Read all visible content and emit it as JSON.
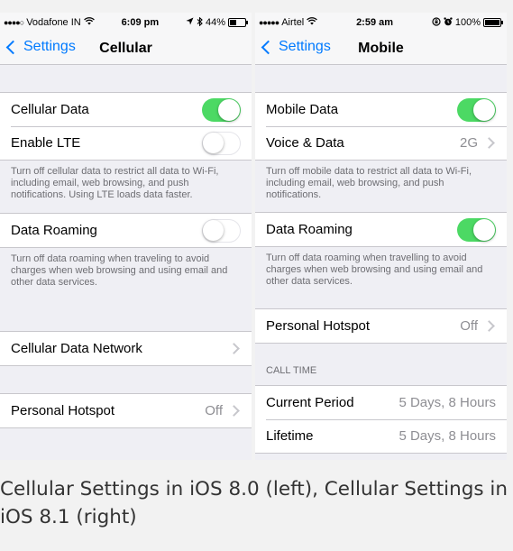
{
  "left": {
    "status": {
      "signal_dots": "●●●●○",
      "carrier": "Vodafone IN",
      "time": "6:09 pm",
      "battery": "44%",
      "battery_level": 0.44
    },
    "nav": {
      "back_label": "Settings",
      "title": "Cellular"
    },
    "group1": {
      "cellular_data": {
        "label": "Cellular Data",
        "on": true
      },
      "enable_lte": {
        "label": "Enable LTE",
        "on": false
      }
    },
    "footer1": "Turn off cellular data to restrict all data to Wi-Fi, including email, web browsing, and push notifications. Using LTE loads data faster.",
    "data_roaming": {
      "label": "Data Roaming",
      "on": false
    },
    "footer2": "Turn off data roaming when traveling to avoid charges when web browsing and using email and other data services.",
    "cellular_data_network": {
      "label": "Cellular Data Network"
    },
    "personal_hotspot": {
      "label": "Personal Hotspot",
      "value": "Off"
    }
  },
  "right": {
    "status": {
      "signal_dots": "●●●●●",
      "carrier": "Airtel",
      "time": "2:59 am",
      "battery": "100%",
      "battery_level": 1.0
    },
    "nav": {
      "back_label": "Settings",
      "title": "Mobile"
    },
    "group1": {
      "mobile_data": {
        "label": "Mobile Data",
        "on": true
      },
      "voice_data": {
        "label": "Voice & Data",
        "value": "2G"
      }
    },
    "footer1": "Turn off mobile data to restrict all data to Wi-Fi, including email, web browsing, and push notifications.",
    "data_roaming": {
      "label": "Data Roaming",
      "on": true
    },
    "footer2": "Turn off data roaming when travelling to avoid charges when web browsing and using email and other data services.",
    "personal_hotspot": {
      "label": "Personal Hotspot",
      "value": "Off"
    },
    "call_time": {
      "header": "CALL TIME",
      "current_period": {
        "label": "Current Period",
        "value": "5 Days, 8 Hours"
      },
      "lifetime": {
        "label": "Lifetime",
        "value": "5 Days, 8 Hours"
      }
    }
  },
  "caption": "Cellular Settings in iOS 8.0 (left), Cellular Settings in iOS 8.1 (right)",
  "colors": {
    "accent": "#007aff",
    "toggle_on": "#4cd964",
    "background": "#efeff4"
  }
}
